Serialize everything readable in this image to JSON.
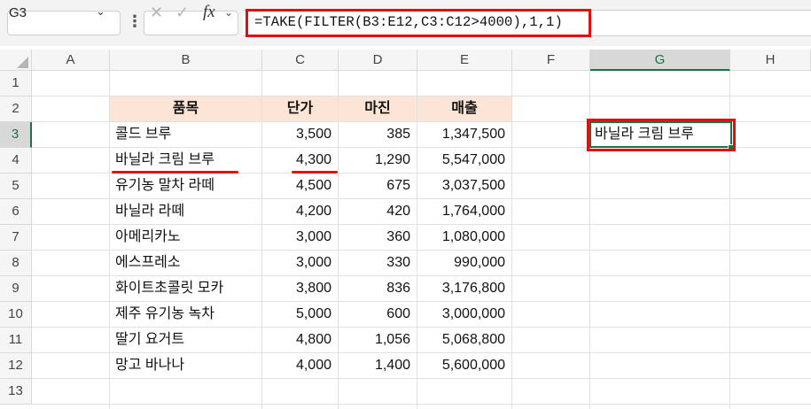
{
  "formula_bar": {
    "name_box": "G3",
    "name_box_chevron": "⌄",
    "more_icon": "⋮",
    "cancel_icon": "✕",
    "enter_icon": "✓",
    "fx_label": "fx",
    "fx_chevron": "⌄",
    "formula": "=TAKE(FILTER(B3:E12,C3:C12>4000),1,1)"
  },
  "columns": [
    "A",
    "B",
    "C",
    "D",
    "E",
    "F",
    "G",
    "H"
  ],
  "selected_column": "G",
  "rows": [
    "1",
    "2",
    "3",
    "4",
    "5",
    "6",
    "7",
    "8",
    "9",
    "10",
    "11",
    "12",
    "13"
  ],
  "selected_row": "3",
  "table": {
    "headers": [
      "품목",
      "단가",
      "마진",
      "매출"
    ],
    "rows": [
      [
        "콜드 브루",
        "3,500",
        "385",
        "1,347,500"
      ],
      [
        "바닐라 크림 브루",
        "4,300",
        "1,290",
        "5,547,000"
      ],
      [
        "유기농 말차 라떼",
        "4,500",
        "675",
        "3,037,500"
      ],
      [
        "바닐라 라떼",
        "4,200",
        "420",
        "1,764,000"
      ],
      [
        "아메리카노",
        "3,000",
        "360",
        "1,080,000"
      ],
      [
        "에스프레소",
        "3,000",
        "330",
        "990,000"
      ],
      [
        "화이트초콜릿 모카",
        "3,800",
        "836",
        "3,176,800"
      ],
      [
        "제주 유기농 녹차",
        "5,000",
        "600",
        "3,000,000"
      ],
      [
        "딸기 요거트",
        "4,800",
        "1,056",
        "5,068,800"
      ],
      [
        "망고 바나나",
        "4,000",
        "1,400",
        "5,600,000"
      ]
    ]
  },
  "result_cell": {
    "address": "G3",
    "value": "바닐라 크림 브루"
  },
  "colors": {
    "header_fill": "#fce4d6",
    "highlight": "#e01010",
    "selection": "#1e7145"
  }
}
